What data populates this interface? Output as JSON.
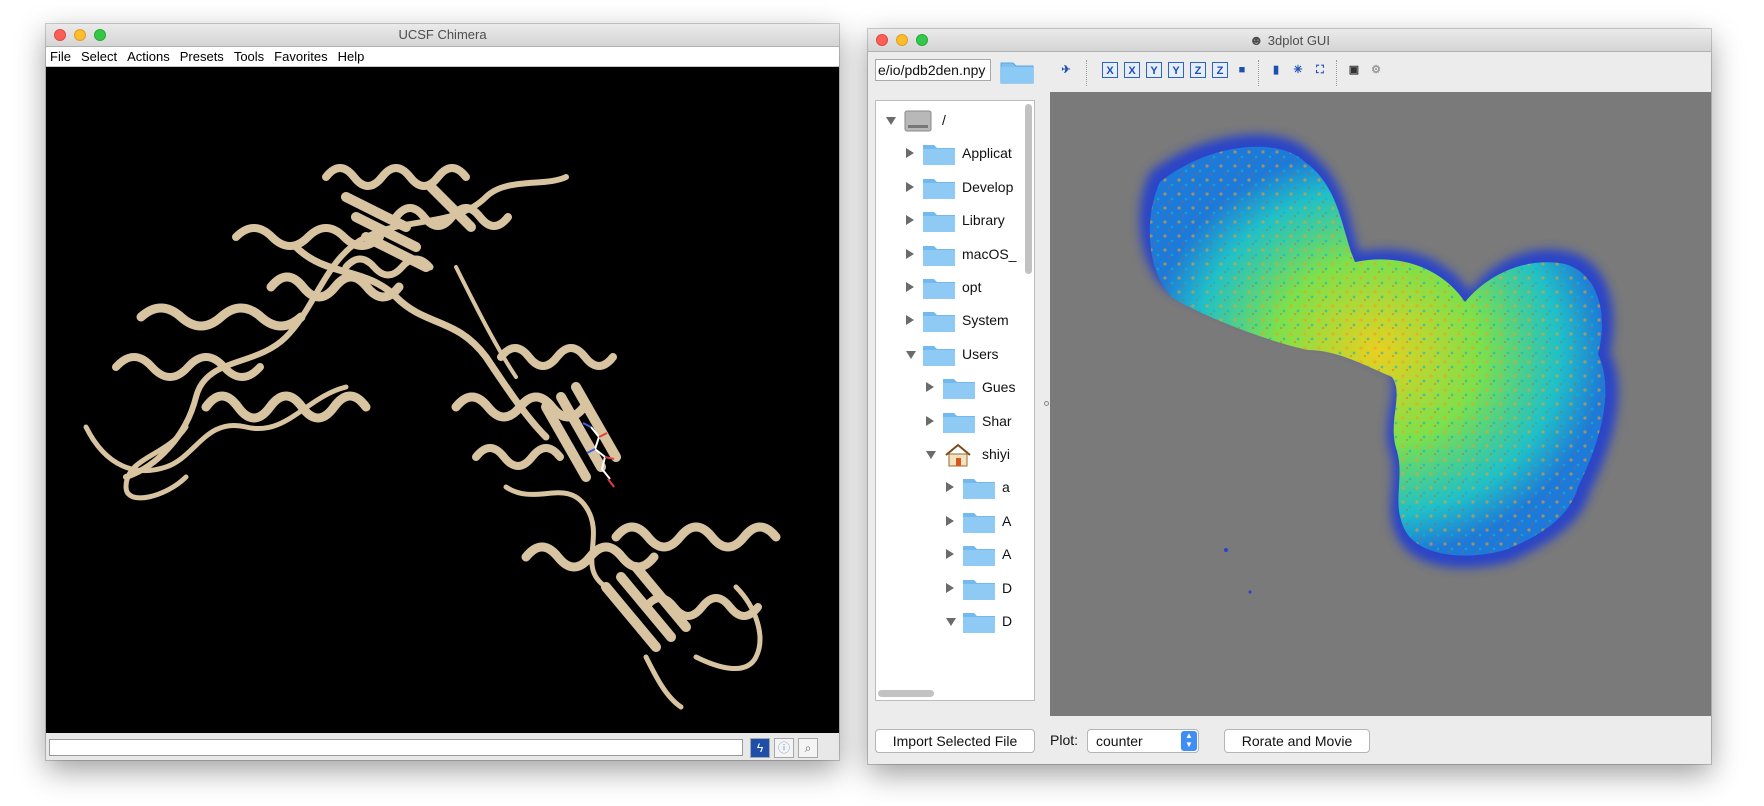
{
  "chimera": {
    "title": "UCSF Chimera",
    "menu": [
      "File",
      "Select",
      "Actions",
      "Presets",
      "Tools",
      "Favorites",
      "Help"
    ],
    "command_value": "",
    "buttons": [
      "lightning-icon",
      "info-icon",
      "magnifier-icon"
    ]
  },
  "plot3d": {
    "title": "3dplot GUI",
    "path_value": "e/io/pdb2den.npy",
    "tree": [
      {
        "label": "/",
        "depth": 0,
        "expanded": true,
        "icon": "disk-icon"
      },
      {
        "label": "Applicat",
        "depth": 1,
        "expanded": false,
        "icon": "applications-folder-icon"
      },
      {
        "label": "Develop",
        "depth": 1,
        "expanded": false,
        "icon": "developer-folder-icon"
      },
      {
        "label": "Library",
        "depth": 1,
        "expanded": false,
        "icon": "library-folder-icon"
      },
      {
        "label": "macOS_",
        "depth": 1,
        "expanded": false,
        "icon": "folder-icon"
      },
      {
        "label": "opt",
        "depth": 1,
        "expanded": false,
        "icon": "folder-icon"
      },
      {
        "label": "System",
        "depth": 1,
        "expanded": false,
        "icon": "system-folder-icon"
      },
      {
        "label": "Users",
        "depth": 1,
        "expanded": true,
        "icon": "users-folder-icon"
      },
      {
        "label": "Gues",
        "depth": 2,
        "expanded": false,
        "icon": "folder-icon"
      },
      {
        "label": "Shar",
        "depth": 2,
        "expanded": false,
        "icon": "folder-icon"
      },
      {
        "label": "shiyi",
        "depth": 2,
        "expanded": true,
        "icon": "home-icon"
      },
      {
        "label": "a",
        "depth": 3,
        "expanded": false,
        "icon": "folder-icon"
      },
      {
        "label": "A",
        "depth": 3,
        "expanded": false,
        "icon": "applications-folder-icon"
      },
      {
        "label": "A",
        "depth": 3,
        "expanded": false,
        "icon": "folder-icon"
      },
      {
        "label": "D",
        "depth": 3,
        "expanded": false,
        "icon": "desktop-folder-icon"
      },
      {
        "label": "D",
        "depth": 3,
        "expanded": true,
        "icon": "documents-folder-icon"
      }
    ],
    "toolbar": [
      {
        "name": "rotate-axes-icon",
        "glyph": "✈"
      },
      {
        "name": "view-x-icon",
        "glyph": "X"
      },
      {
        "name": "view-x-reverse-icon",
        "glyph": "X"
      },
      {
        "name": "view-y-icon",
        "glyph": "Y"
      },
      {
        "name": "view-y-reverse-icon",
        "glyph": "Y"
      },
      {
        "name": "view-z-icon",
        "glyph": "Z"
      },
      {
        "name": "view-z-reverse-icon",
        "glyph": "Z"
      },
      {
        "name": "cube-icon",
        "glyph": "■"
      },
      {
        "name": "colorbar-icon",
        "glyph": "▮"
      },
      {
        "name": "points-icon",
        "glyph": "✳"
      },
      {
        "name": "fit-view-icon",
        "glyph": "⛶"
      },
      {
        "name": "save-icon",
        "glyph": "▣"
      },
      {
        "name": "settings-icon",
        "glyph": "⚙"
      }
    ],
    "import_button": "Import Selected File",
    "plot_label": "Plot:",
    "plot_value": "counter",
    "movie_button": "Rorate and Movie"
  }
}
